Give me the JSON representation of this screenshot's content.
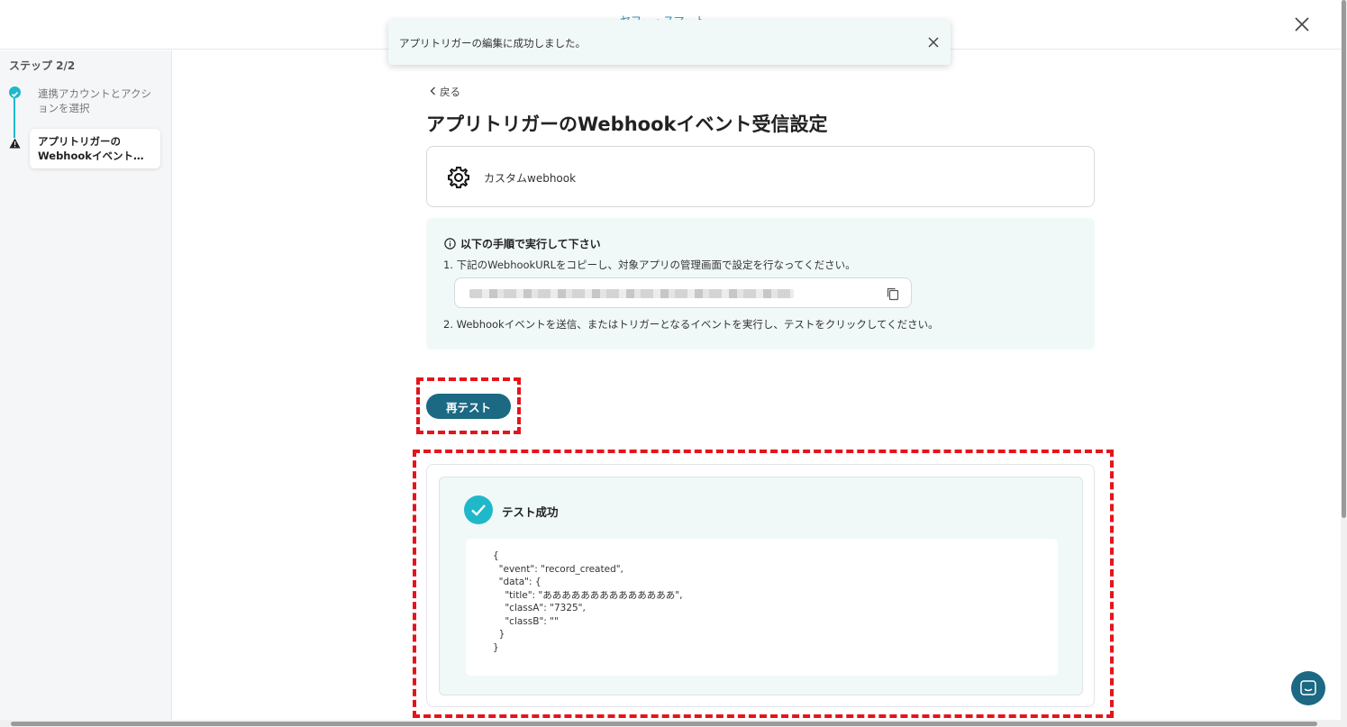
{
  "topbar": {
    "logo_text": "ヤフー・スマートシート"
  },
  "sidebar": {
    "step_count": "ステップ 2/2",
    "steps": [
      {
        "label": "連携アカウントとアクションを選択"
      },
      {
        "label_line1": "アプリトリガーの",
        "label_line2": "Webhookイベント受信..."
      }
    ]
  },
  "toast": {
    "message": "アプリトリガーの編集に成功しました。"
  },
  "main": {
    "back_label": "戻る",
    "title": "アプリトリガーのWebhookイベント受信設定",
    "app_name": "カスタムwebhook",
    "info": {
      "heading": "以下の手順で実行して下さい",
      "step1": "1. 下記のWebhookURLをコピーし、対象アプリの管理画面で設定を行なってください。",
      "step2": "2. Webhookイベントを送信、またはトリガーとなるイベントを実行し、テストをクリックしてください。"
    },
    "retest_label": "再テスト",
    "result": {
      "status": "テスト成功",
      "json_lines": [
        "{",
        "  \"event\": \"record_created\",",
        "  \"data\": {",
        "    \"title\": \"ああああああああああああああ\",",
        "    \"classA\": \"7325\",",
        "    \"classB\": \"\"",
        "  }",
        "}"
      ]
    }
  },
  "colors": {
    "accent": "#1fb8c9",
    "primary": "#1b6983",
    "highlight": "#e5141c"
  },
  "icons": [
    "gear-icon",
    "copy-icon",
    "check-icon",
    "info-icon",
    "close-icon",
    "chat-icon"
  ]
}
